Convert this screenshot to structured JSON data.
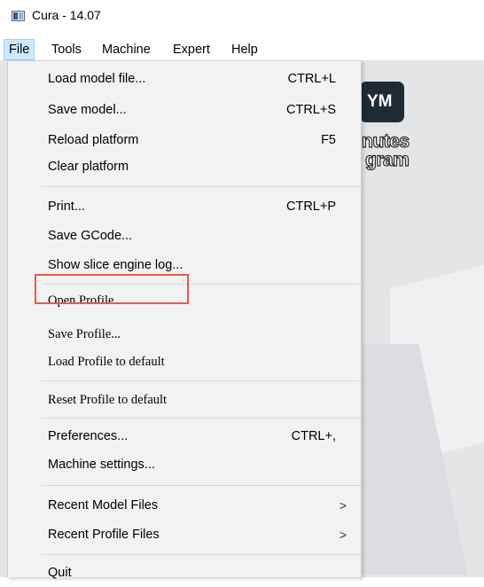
{
  "window": {
    "title": "Cura - 14.07"
  },
  "menubar": {
    "items": [
      "File",
      "Tools",
      "Machine",
      "Expert",
      "Help"
    ]
  },
  "menu": {
    "load_model": {
      "label": "Load model file...",
      "shortcut": "CTRL+L"
    },
    "save_model": {
      "label": "Save model...",
      "shortcut": "CTRL+S"
    },
    "reload_platform": {
      "label": "Reload platform",
      "shortcut": "F5"
    },
    "clear_platform": {
      "label": "Clear platform"
    },
    "print": {
      "label": "Print...",
      "shortcut": "CTRL+P"
    },
    "save_gcode": {
      "label": "Save GCode..."
    },
    "show_log": {
      "label": "Show slice engine log..."
    },
    "open_profile": {
      "label": "Open Profile..."
    },
    "save_profile": {
      "label": "Save Profile..."
    },
    "load_profile_default": {
      "label": "Load Profile to default"
    },
    "reset_profile_default": {
      "label": "Reset Profile to default"
    },
    "preferences": {
      "label": "Preferences...",
      "shortcut": "CTRL+,"
    },
    "machine_settings": {
      "label": "Machine settings..."
    },
    "recent_model_files": {
      "label": "Recent Model Files",
      "arrow": ">"
    },
    "recent_profile_files": {
      "label": "Recent Profile Files",
      "arrow": ">"
    },
    "quit": {
      "label": "Quit"
    }
  },
  "background": {
    "logo_badge": "YM",
    "logo_line_1": "nutes",
    "logo_line_2": "gram"
  },
  "colors": {
    "highlight_border": "#ea5a48",
    "active_menu_bg": "#cce8ff",
    "menu_bg": "#f2f2f2"
  }
}
